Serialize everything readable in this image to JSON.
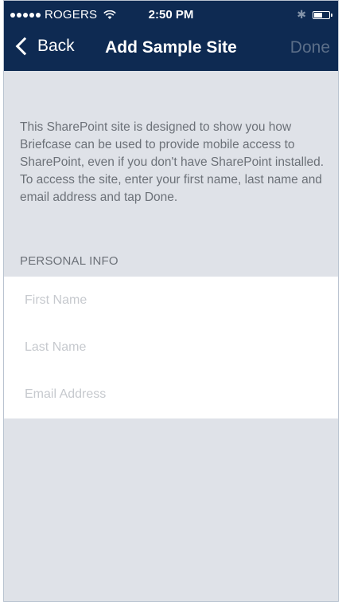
{
  "status_bar": {
    "carrier": "ROGERS",
    "time": "2:50 PM",
    "signal_dots": 5,
    "battery_level": 0.6
  },
  "nav": {
    "back_label": "Back",
    "title": "Add Sample Site",
    "done_label": "Done"
  },
  "intro_text": "This SharePoint site is designed to show you how Briefcase can be used to provide mobile access to SharePoint, even if you don't have SharePoint installed. To access the site, enter your first name, last name and email address and tap Done.",
  "section": {
    "header": "PERSONAL INFO"
  },
  "form": {
    "first_name": {
      "placeholder": "First Name",
      "value": ""
    },
    "last_name": {
      "placeholder": "Last Name",
      "value": ""
    },
    "email": {
      "placeholder": "Email Address",
      "value": ""
    }
  },
  "colors": {
    "nav_background": "#0e2a52",
    "done_disabled": "#5b6e88",
    "page_background": "#dfe2e8"
  },
  "icons": {
    "back": "chevron-left-icon",
    "wifi": "wifi-icon",
    "bluetooth": "bluetooth-icon",
    "battery": "battery-icon"
  }
}
